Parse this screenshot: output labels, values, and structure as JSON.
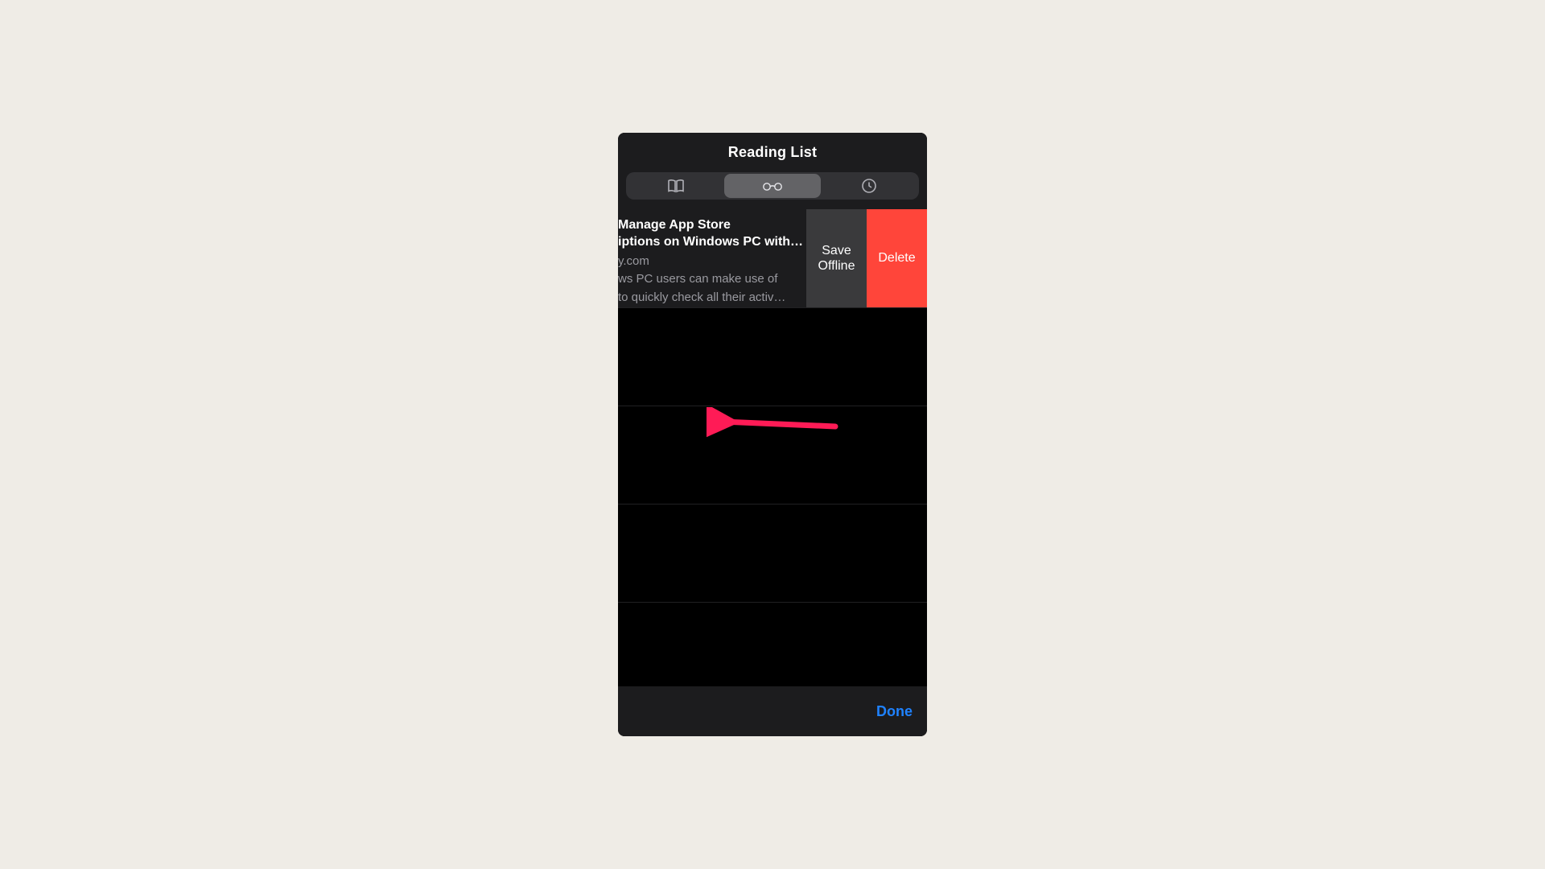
{
  "header": {
    "title": "Reading List"
  },
  "segments": {
    "bookmarks": "bookmarks",
    "readinglist": "reading-list",
    "history": "history",
    "selected": 1
  },
  "item": {
    "title_line1": " Manage App Store",
    "title_line2": "iptions on Windows PC with…",
    "domain": "y.com",
    "desc_line1": "ws PC users can make use of",
    "desc_line2": "to quickly check all their activ…"
  },
  "swipe_actions": {
    "save_offline": "Save\nOffline",
    "delete": "Delete"
  },
  "footer": {
    "done": "Done"
  },
  "annotation": {
    "arrow_color": "#ff1b56"
  }
}
